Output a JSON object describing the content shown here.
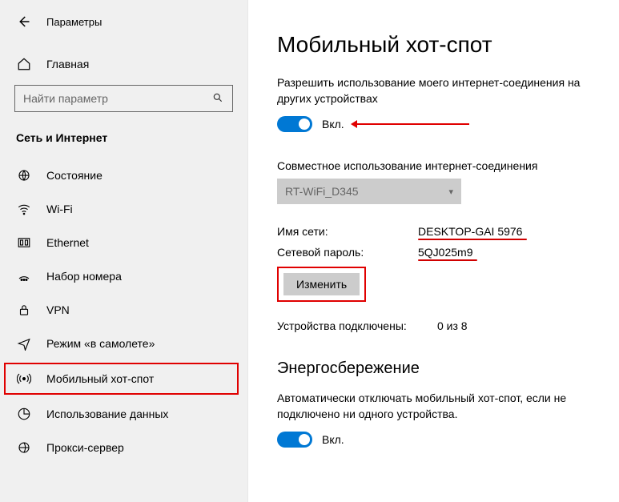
{
  "header": {
    "title": "Параметры"
  },
  "home": {
    "label": "Главная"
  },
  "search": {
    "placeholder": "Найти параметр"
  },
  "section": {
    "label": "Сеть и Интернет"
  },
  "nav": {
    "items": [
      {
        "label": "Состояние"
      },
      {
        "label": "Wi-Fi"
      },
      {
        "label": "Ethernet"
      },
      {
        "label": "Набор номера"
      },
      {
        "label": "VPN"
      },
      {
        "label": "Режим «в самолете»"
      },
      {
        "label": "Мобильный хот-спот"
      },
      {
        "label": "Использование данных"
      },
      {
        "label": "Прокси-сервер"
      }
    ]
  },
  "main": {
    "title": "Мобильный хот-спот",
    "share_desc": "Разрешить использование моего интернет-соединения на других устройствах",
    "toggle1": "Вкл.",
    "share_conn_label": "Совместное использование интернет-соединения",
    "conn_value": "RT-WiFi_D345",
    "net_name_key": "Имя сети:",
    "net_name_val": "DESKTOP-GAI 5976",
    "net_pass_key": "Сетевой пароль:",
    "net_pass_val": "5QJ025m9",
    "edit_btn": "Изменить",
    "devices_key": "Устройства подключены:",
    "devices_val": "0 из 8",
    "energy_title": "Энергосбережение",
    "energy_desc": "Автоматически отключать мобильный хот-спот, если не подключено ни одного устройства.",
    "toggle2": "Вкл."
  }
}
